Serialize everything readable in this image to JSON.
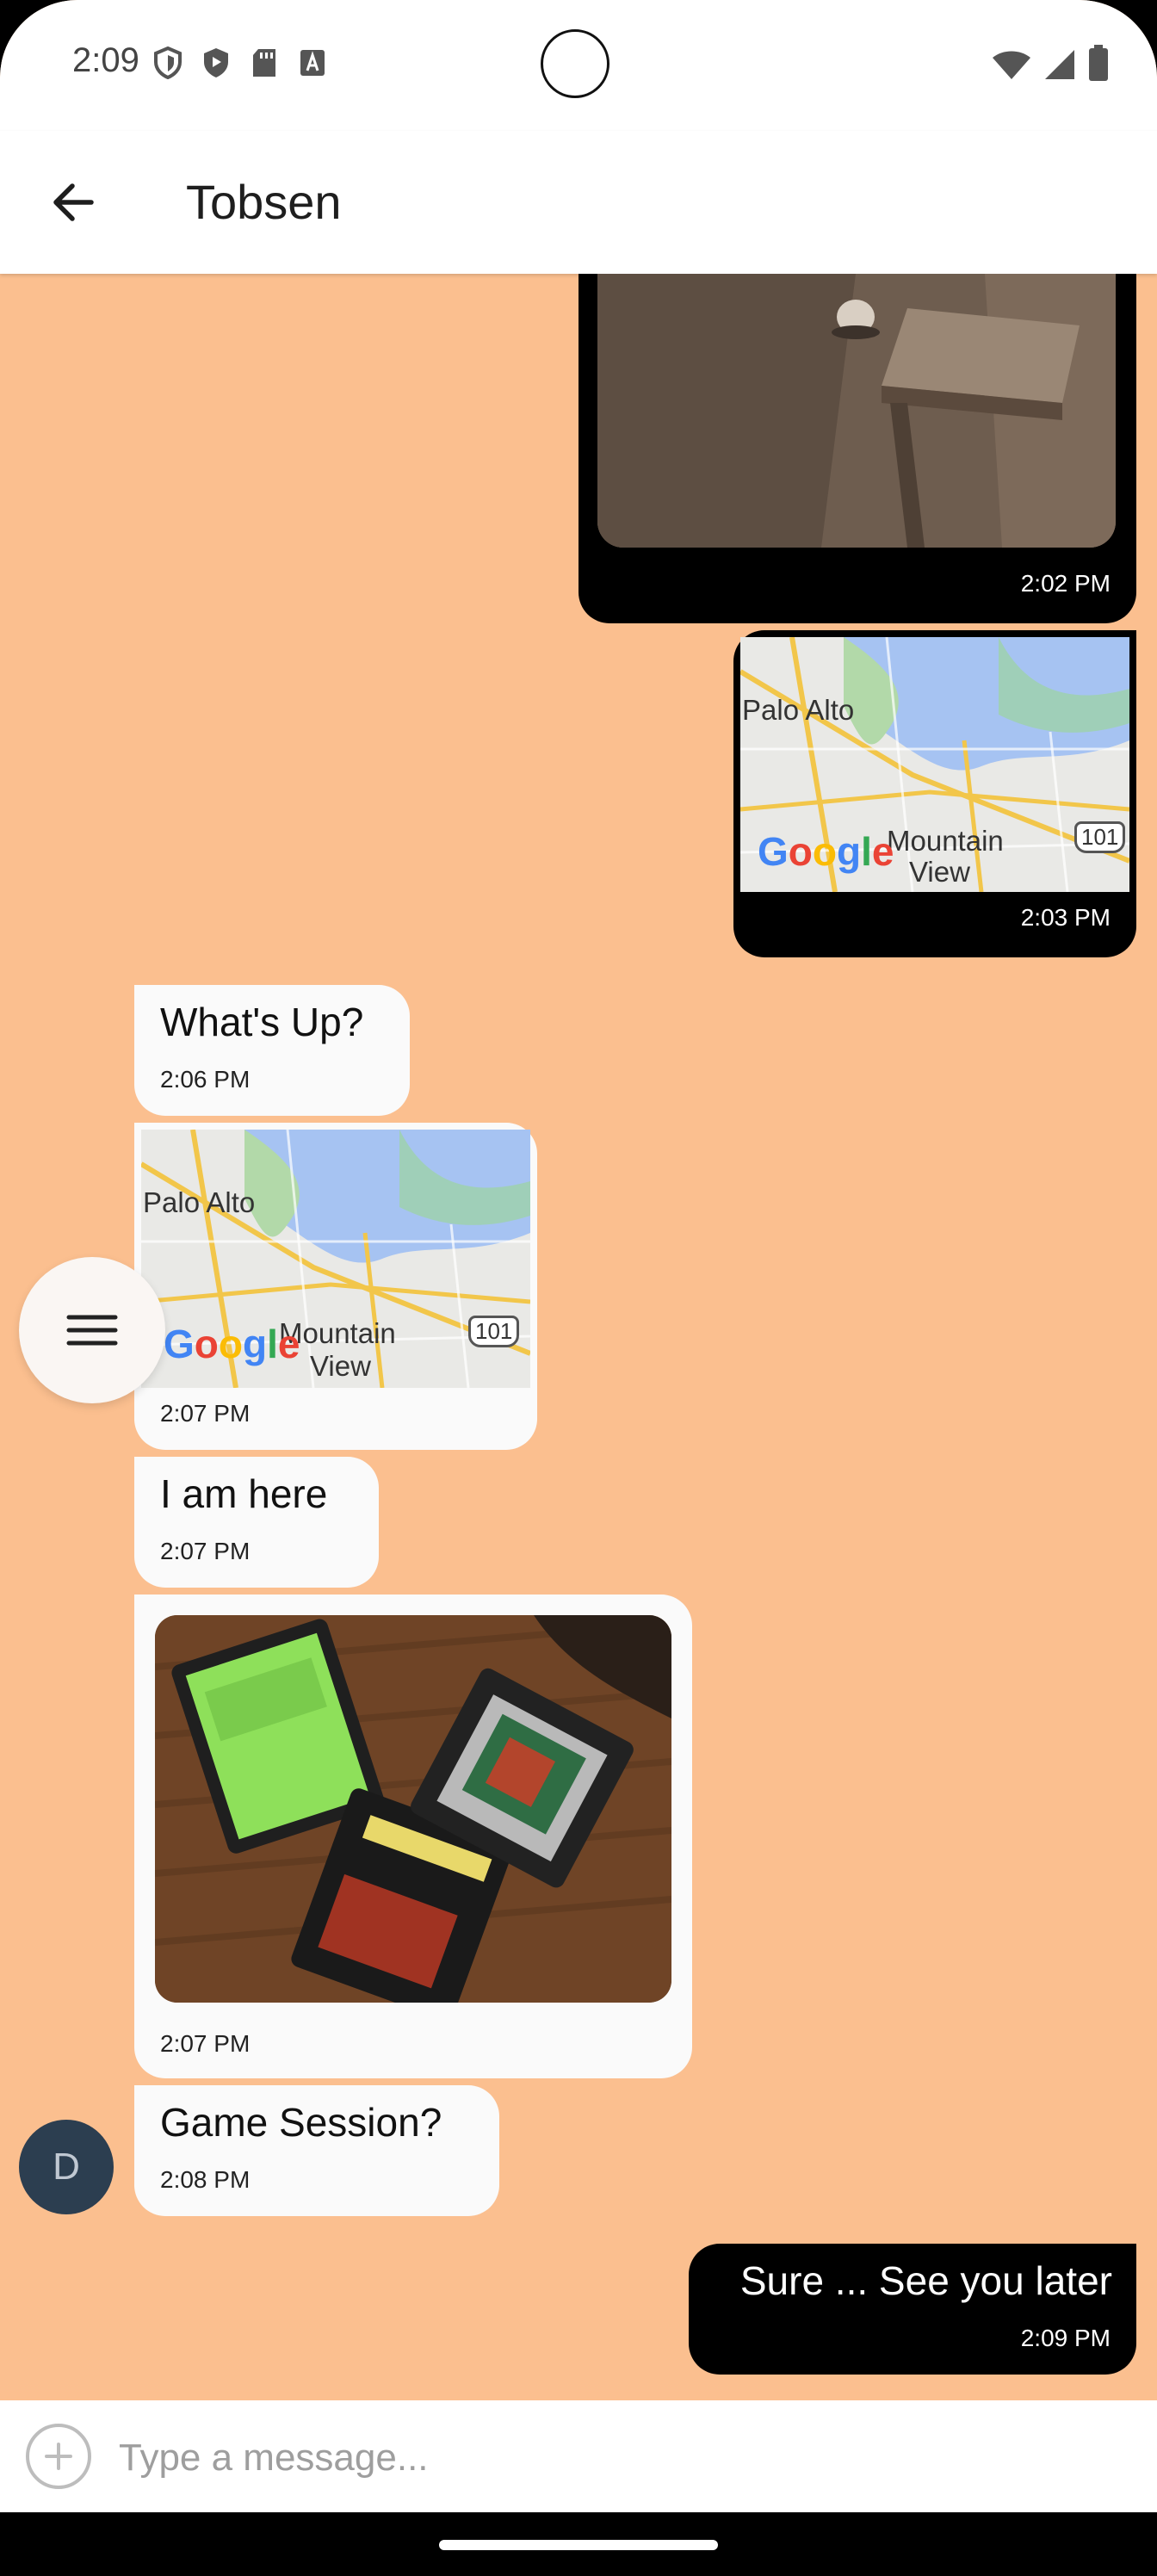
{
  "status_bar": {
    "time": "2:09",
    "icons_left": [
      "shield-outline-icon",
      "shield-play-icon",
      "sd-card-icon",
      "font-a-icon"
    ],
    "icons_right": [
      "wifi-icon",
      "cell-signal-icon",
      "battery-icon"
    ]
  },
  "app_bar": {
    "title": "Tobsen",
    "back_icon": "arrow-left-icon"
  },
  "messages": [
    {
      "direction": "out",
      "type": "image",
      "time": "2:02 PM"
    },
    {
      "direction": "out",
      "type": "map",
      "time": "2:03 PM",
      "labels": {
        "city1": "Palo Alto",
        "city2": "Mountain",
        "city2b": "View",
        "highway": "101",
        "logo": "Google"
      }
    },
    {
      "direction": "in",
      "type": "text",
      "text": "What's Up?",
      "time": "2:06 PM"
    },
    {
      "direction": "in",
      "type": "map",
      "time": "2:07 PM",
      "labels": {
        "city1": "Palo Alto",
        "city2": "Mountain",
        "city2b": "View",
        "highway": "101",
        "logo": "Google"
      }
    },
    {
      "direction": "in",
      "type": "text",
      "text": "I am here",
      "time": "2:07 PM"
    },
    {
      "direction": "in",
      "type": "image",
      "time": "2:07 PM"
    },
    {
      "direction": "in",
      "type": "text",
      "text": "Game Session?",
      "time": "2:08 PM"
    },
    {
      "direction": "out",
      "type": "text",
      "text": "Sure ... See you later",
      "time": "2:09 PM"
    }
  ],
  "avatar": {
    "initial": "D"
  },
  "fab": {
    "icon": "menu-icon"
  },
  "composer": {
    "placeholder": "Type a message...",
    "add_icon": "plus-circle-icon"
  },
  "colors": {
    "chat_background": "#fbbf8f",
    "outgoing_bubble": "#000000",
    "incoming_bubble": "#fafafa",
    "avatar": "#2c3e50"
  }
}
